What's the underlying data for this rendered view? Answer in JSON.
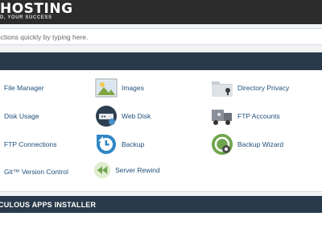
{
  "header": {
    "brand": "HOSTING",
    "tagline": "D, YOUR SUCCESS"
  },
  "search": {
    "placeholder": "nctions quickly by typing here."
  },
  "files_section": {
    "title": ""
  },
  "files": {
    "items": [
      {
        "label": "File Manager",
        "icon": "file-manager-icon"
      },
      {
        "label": "Images",
        "icon": "images-icon"
      },
      {
        "label": "Directory Privacy",
        "icon": "directory-privacy-icon"
      },
      {
        "label": "Disk Usage",
        "icon": "disk-usage-icon"
      },
      {
        "label": "Web Disk",
        "icon": "web-disk-icon"
      },
      {
        "label": "FTP Accounts",
        "icon": "ftp-accounts-icon"
      },
      {
        "label": "FTP Connections",
        "icon": "ftp-connections-icon"
      },
      {
        "label": "Backup",
        "icon": "backup-icon"
      },
      {
        "label": "Backup Wizard",
        "icon": "backup-wizard-icon"
      },
      {
        "label": "Git™ Version Control",
        "icon": "git-icon"
      },
      {
        "label": "Server Rewind",
        "icon": "server-rewind-icon"
      }
    ]
  },
  "apps_section": {
    "title": "CULOUS APPS INSTALLER"
  },
  "colors": {
    "topbar": "#2c2c2c",
    "section_header": "#293a4a",
    "link": "#1f4f7a",
    "page_bg": "#f1f3f5"
  }
}
